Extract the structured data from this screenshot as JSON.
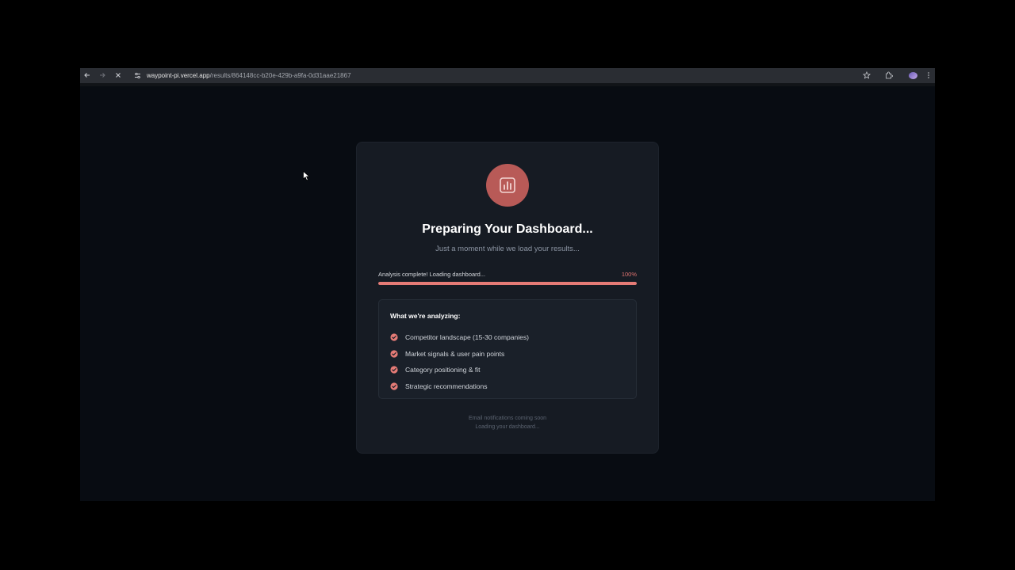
{
  "browser": {
    "url_host": "waypoint-pi.vercel.app",
    "url_path": "/results/864148cc-b20e-429b-a9fa-0d31aae21867"
  },
  "loading_card": {
    "title": "Preparing Your Dashboard...",
    "subtitle": "Just a moment while we load your results...",
    "progress": {
      "label": "Analysis complete! Loading dashboard...",
      "percent_text": "100%",
      "value": 1.0
    },
    "analysis_box": {
      "heading": "What we're analyzing:",
      "items": [
        {
          "label": "Competitor landscape (15-30 companies)"
        },
        {
          "label": "Market signals & user pain points"
        },
        {
          "label": "Category positioning & fit"
        },
        {
          "label": "Strategic recommendations"
        }
      ]
    },
    "footer": {
      "line1": "Email notifications coming soon",
      "line2": "Loading your dashboard..."
    }
  },
  "colors": {
    "accent": "#e57b76",
    "logo_bg": "#b85a57",
    "card_bg": "#161b23",
    "page_bg": "#080c12"
  },
  "icons": {
    "logo": "bar-chart-icon",
    "check": "check-circle-icon"
  }
}
